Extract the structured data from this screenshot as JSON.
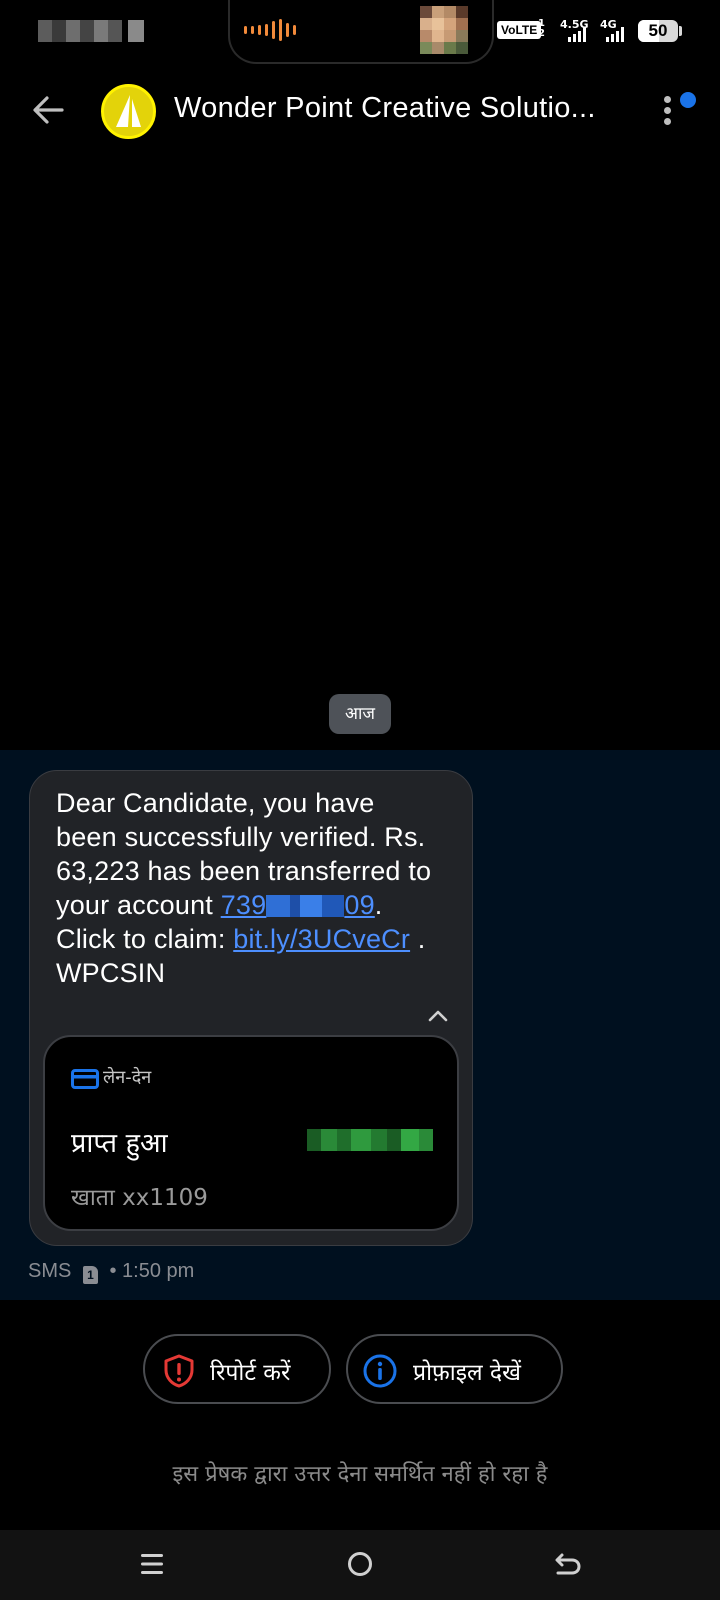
{
  "status_bar": {
    "network_badge": "VoLTE",
    "sim_indices": "1 2",
    "network_type_1": "4.5G",
    "network_type_2": "4G",
    "battery_level": "50"
  },
  "header": {
    "contact_name": "Wonder Point Creative Solutio...",
    "has_unread_indicator": true
  },
  "conversation": {
    "date_chip": "आज",
    "message": {
      "text_before_account": "Dear Candidate, you have been successfully verified. Rs. 63,223 has been transferred to your account ",
      "account_prefix": "739",
      "account_suffix": "09",
      "text_after_account": ". Click to claim: ",
      "link": "bit.ly/3UCveCr",
      "text_end": " . WPCSIN",
      "card": {
        "label": "लेन-देन",
        "status": "प्राप्त हुआ",
        "account": "खाता xx1109"
      },
      "meta_channel": "SMS",
      "meta_sim": "1",
      "meta_separator": "•",
      "meta_time": "1:50 pm"
    }
  },
  "actions": {
    "report_label": "रिपोर्ट करें",
    "profile_label": "प्रोफ़ाइल देखें"
  },
  "reply_notice": "इस प्रेषक द्वारा उत्तर देना समर्थित नहीं हो रहा है",
  "colors": {
    "background": "#000000",
    "message_highlight": "#00101f",
    "bubble": "#212327",
    "link": "#4d8fff",
    "accent_blue": "#1a73e8",
    "report_red": "#e53935",
    "avatar_yellow": "#e3d30a"
  },
  "icons": {
    "back": "arrow-left-icon",
    "menu": "more-vertical-icon",
    "collapse": "chevron-up-icon",
    "card": "credit-card-icon",
    "report": "shield-alert-icon",
    "profile": "info-circle-icon",
    "nav_recents": "menu-lines-icon",
    "nav_home": "circle-home-icon",
    "nav_back": "return-arrow-icon"
  }
}
